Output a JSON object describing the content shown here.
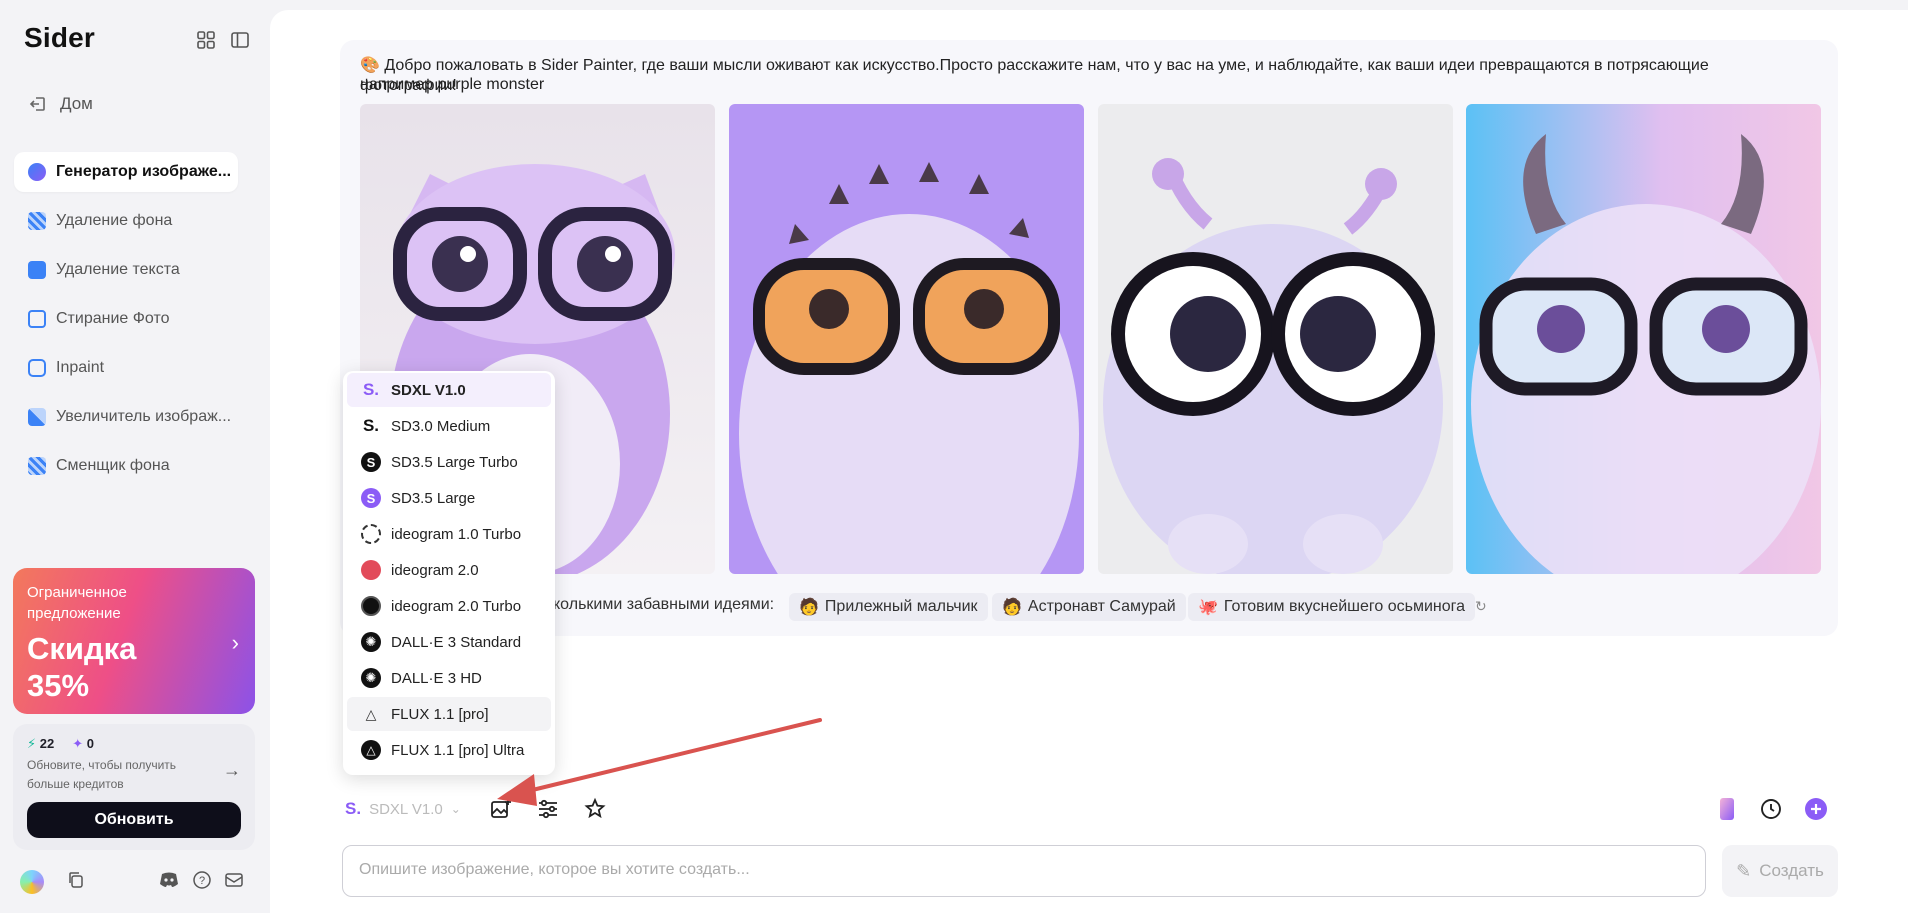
{
  "app": {
    "logo": "Sider"
  },
  "sidebar": {
    "home_label": "Дом",
    "items": [
      {
        "label": "Генератор изображе...",
        "icon": "image-generator-icon",
        "color": "#3b82f6",
        "active": true
      },
      {
        "label": "Удаление фона",
        "icon": "remove-background-icon",
        "color": "#3b82f6"
      },
      {
        "label": "Удаление текста",
        "icon": "remove-text-icon",
        "color": "#3b82f6"
      },
      {
        "label": "Стирание Фото",
        "icon": "photo-eraser-icon",
        "color": "#3b82f6"
      },
      {
        "label": "Inpaint",
        "icon": "inpaint-icon",
        "color": "#3b82f6"
      },
      {
        "label": "Увеличитель изображ...",
        "icon": "upscaler-icon",
        "color": "#3b82f6"
      },
      {
        "label": "Сменщик фона",
        "icon": "background-changer-icon",
        "color": "#3b82f6"
      }
    ],
    "promo": {
      "subtitle": "Ограниченное предложение",
      "title": "Скидка 35%"
    },
    "credits": {
      "fast_count": "22",
      "advanced_count": "0",
      "hint": "Обновите, чтобы получить больше кредитов",
      "upgrade_label": "Обновить"
    }
  },
  "main": {
    "welcome": "Добро пожаловать в Sider Painter, где ваши мысли оживают как искусство.Просто расскажите нам, что у вас на уме, и наблюдайте, как ваши идеи превращаются в потрясающие фотографии!",
    "example": "например purple monster",
    "suggest_label": "сколькими забавными идеями:",
    "chips": [
      {
        "label": "Прилежный мальчик",
        "emoji": "🧑"
      },
      {
        "label": "Астронавт Самурай",
        "emoji": "🧑"
      },
      {
        "label": "Готовим вкуснейшего осьминога",
        "emoji": "🐙"
      }
    ]
  },
  "dropdown": {
    "options": [
      {
        "label": "SDXL V1.0",
        "selected": true
      },
      {
        "label": "SD3.0 Medium"
      },
      {
        "label": "SD3.5 Large Turbo"
      },
      {
        "label": "SD3.5 Large"
      },
      {
        "label": "ideogram 1.0 Turbo"
      },
      {
        "label": "ideogram 2.0"
      },
      {
        "label": "ideogram 2.0 Turbo"
      },
      {
        "label": "DALL·E 3 Standard"
      },
      {
        "label": "DALL·E 3 HD"
      },
      {
        "label": "FLUX 1.1 [pro]",
        "hovered": true
      },
      {
        "label": "FLUX 1.1 [pro] Ultra"
      }
    ]
  },
  "toolbar": {
    "model_value": "SDXL V1.0",
    "prompt_placeholder": "Опишите изображение, которое вы хотите создать...",
    "create_label": "Создать"
  },
  "colors": {
    "accent": "#8b5cf6",
    "selected_bg": "#f4effd",
    "annotation_arrow": "#d9534f"
  }
}
